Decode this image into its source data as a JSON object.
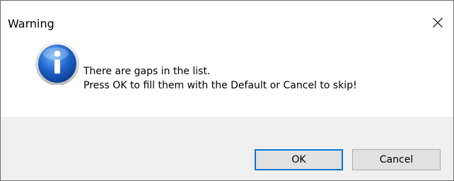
{
  "dialog": {
    "title": "Warning",
    "message_lines": [
      "There are gaps in the list.",
      "Press OK to fill them with the Default or Cancel to skip!"
    ],
    "icon": "information-icon",
    "buttons": {
      "ok_label": "OK",
      "cancel_label": "Cancel"
    },
    "close_glyph": "×"
  },
  "colors": {
    "footer_bg": "#f0f0f0",
    "button_bg": "#e1e1e1",
    "focus_border": "#0078d7",
    "icon_blue": "#1e62c9"
  }
}
